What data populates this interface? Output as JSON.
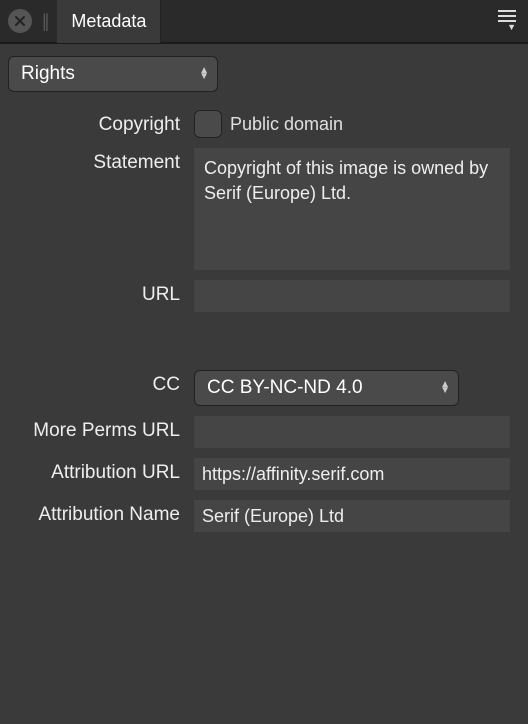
{
  "titlebar": {
    "tab_label": "Metadata"
  },
  "category_dropdown": {
    "value": "Rights"
  },
  "fields": {
    "copyright_label": "Copyright",
    "public_domain_label": "Public domain",
    "statement_label": "Statement",
    "statement_value": "Copyright of this image is owned by Serif (Europe) Ltd.",
    "url_label": "URL",
    "url_value": "",
    "cc_label": "CC",
    "cc_value": "CC BY-NC-ND 4.0",
    "more_perms_label": "More Perms URL",
    "more_perms_value": "",
    "attribution_url_label": "Attribution URL",
    "attribution_url_value": "https://affinity.serif.com",
    "attribution_name_label": "Attribution Name",
    "attribution_name_value": "Serif (Europe) Ltd"
  }
}
